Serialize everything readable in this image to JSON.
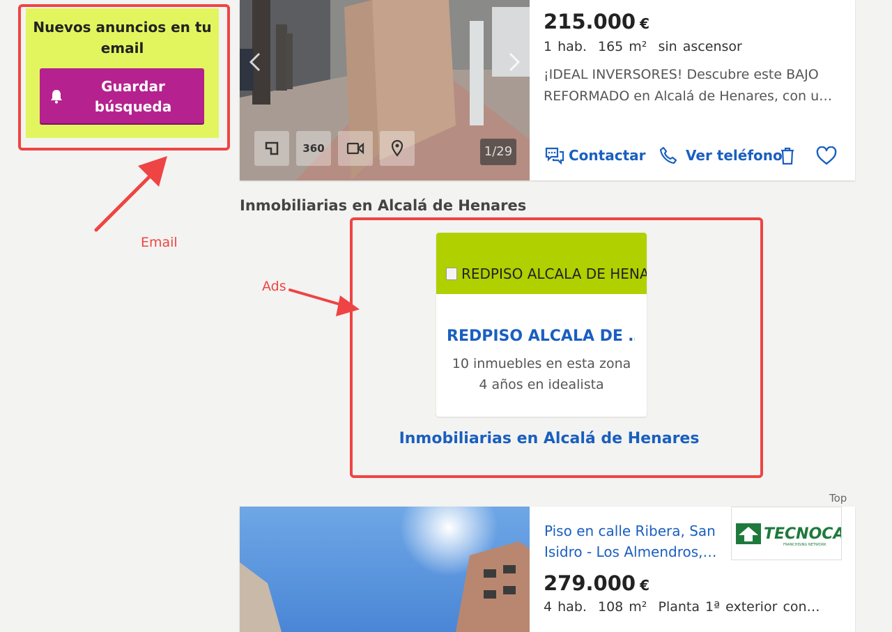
{
  "email_promo": {
    "title": "Nuevos anuncios en tu email",
    "button_label": "Guardar búsqueda"
  },
  "annotations": {
    "email_label": "Email",
    "ads_label": "Ads",
    "color": "#ee4444"
  },
  "listing1": {
    "price": "215.000",
    "currency": "€",
    "details": "1 hab.  165 m²  sin ascensor",
    "description": "¡IDEAL INVERSORES! Descubre este BAJO REFORMADO en Alcalá de Henares, con u…",
    "photo_counter": "1/29",
    "tools": [
      "plan-icon",
      "360",
      "video-icon",
      "map-pin-icon"
    ],
    "tool_360_label": "360",
    "actions": {
      "contact": "Contactar",
      "phone": "Ver teléfono"
    }
  },
  "agencies": {
    "section_title": "Inmobiliarias en Alcalá de Henares",
    "card": {
      "image_alt": "REDPISO ALCALA DE HENARES",
      "name": "REDPISO ALCALA DE …",
      "properties": "10 inmuebles en esta zona",
      "years": "4 años en idealista",
      "banner_color": "#b0d000"
    },
    "link": "Inmobiliarias en Alcalá de Henares"
  },
  "listing2": {
    "top_label": "Top",
    "title": "Piso en calle Ribera, San Isidro - Los Almendros,…",
    "price": "279.000",
    "currency": "€",
    "details": "4 hab.  108 m²  Planta 1ª exterior con…",
    "agency_logo": "TECNOCASA",
    "agency_logo_sub": "FRANCHISING NETWORK"
  },
  "colors": {
    "accent_blue": "#1a5fbf",
    "promo_bg": "#e2f55f",
    "button_bg": "#b5218e"
  }
}
